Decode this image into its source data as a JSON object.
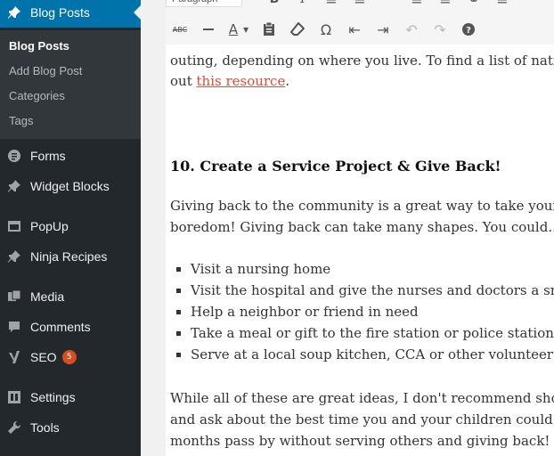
{
  "sidebar": {
    "items": [
      {
        "label": "Blog Posts",
        "icon": "pin-icon"
      },
      {
        "label": "Forms",
        "icon": "forms-icon"
      },
      {
        "label": "Widget Blocks",
        "icon": "pin-icon"
      },
      {
        "label": "PopUp",
        "icon": "popup-icon"
      },
      {
        "label": "Ninja Recipes",
        "icon": "pin-icon"
      },
      {
        "label": "Media",
        "icon": "media-icon"
      },
      {
        "label": "Comments",
        "icon": "comment-icon"
      },
      {
        "label": "SEO",
        "icon": "seo-icon",
        "badge": "5"
      },
      {
        "label": "Settings",
        "icon": "settings-icon"
      },
      {
        "label": "Tools",
        "icon": "wrench-icon"
      }
    ],
    "submenu": [
      "Blog Posts",
      "Add Blog Post",
      "Categories",
      "Tags"
    ]
  },
  "toolbar": {
    "format_select": "Paragraph",
    "strike_label": "ABC",
    "text_color_label": "A",
    "special_char_label": "Ω"
  },
  "content": {
    "line1": "outing, depending on where you live. To find a list of national",
    "line2_pre": "out ",
    "line2_link": "this resource",
    "line2_post": ".",
    "heading": "10. Create a Service Project & Give Back!",
    "para1_line1": "Giving back to the community is a great way to take your kids",
    "para1_line2": "boredom! Giving back can take many shapes. You could...",
    "list": [
      "Visit a nursing home",
      "Visit the hospital and give the nurses and doctors a small g",
      "Help a neighbor or friend in need",
      "Take a meal or gift to the fire station or police station",
      "Serve at a local soup kitchen, CCA or other volunteer orga"
    ],
    "para2_line1": "While all of these are great ideas, I don't recommend showing",
    "para2_line2": "and ask about the best time you and your children could drop",
    "para2_line3": "months pass by without serving others and giving back!"
  },
  "colors": {
    "sidebar_bg": "#23282d",
    "submenu_bg": "#32373c",
    "active_bg": "#0073aa",
    "link": "#dd4b39",
    "badge": "#d54e21"
  }
}
